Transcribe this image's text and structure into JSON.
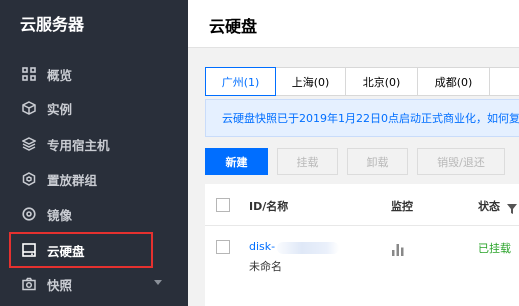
{
  "sidebar": {
    "title": "云服务器",
    "items": [
      {
        "label": "概览",
        "icon": "grid-icon"
      },
      {
        "label": "实例",
        "icon": "cube-icon"
      },
      {
        "label": "专用宿主机",
        "icon": "layers-icon"
      },
      {
        "label": "置放群组",
        "icon": "hexagon-icon"
      },
      {
        "label": "镜像",
        "icon": "disc-icon"
      },
      {
        "label": "云硬盘",
        "icon": "disk-icon"
      },
      {
        "label": "快照",
        "icon": "camera-icon"
      }
    ],
    "active_item": "云硬盘"
  },
  "main": {
    "title": "云硬盘",
    "regions": [
      {
        "label": "广州(1)",
        "active": true
      },
      {
        "label": "上海(0)",
        "active": false
      },
      {
        "label": "北京(0)",
        "active": false
      },
      {
        "label": "成都(0)",
        "active": false
      },
      {
        "label": "",
        "active": false
      }
    ],
    "notice": "云硬盘快照已于2019年1月22日0点启动正式商业化，如何复",
    "toolbar": {
      "new": "新建",
      "mount": "挂载",
      "unmount": "卸载",
      "destroy": "销毁/退还"
    },
    "table": {
      "headers": {
        "id_name": "ID/名称",
        "monitor": "监控",
        "status": "状态"
      },
      "rows": [
        {
          "id": "disk-",
          "name": "未命名",
          "status": "已挂载"
        }
      ]
    }
  },
  "colors": {
    "sidebar_bg": "#292f3a",
    "accent": "#006eff",
    "status_green": "#29a329",
    "highlight_red": "#e5312f"
  }
}
